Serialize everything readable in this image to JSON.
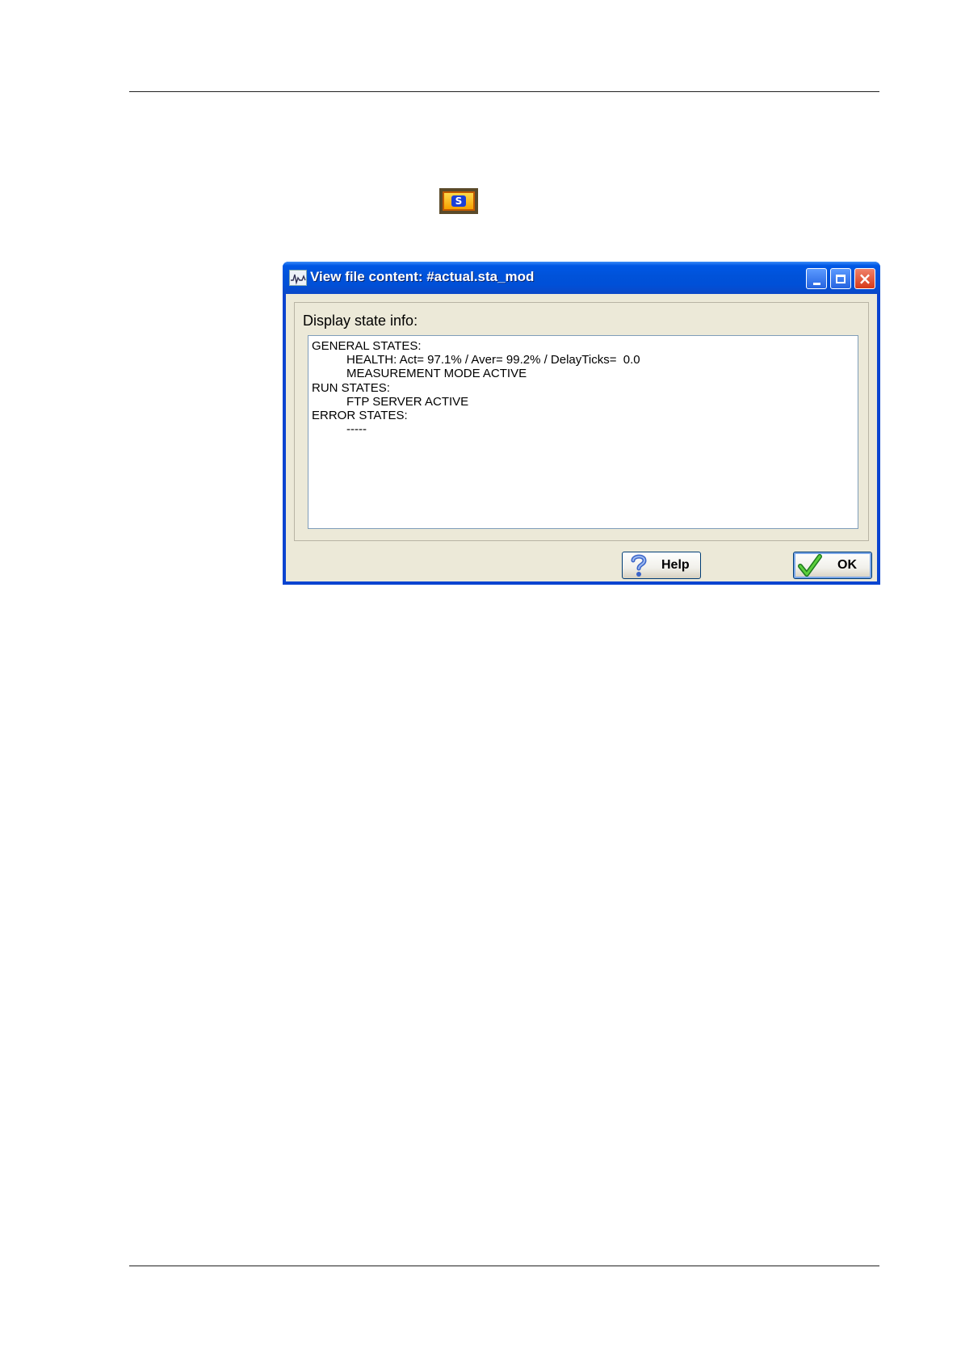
{
  "window": {
    "title": "View file content: #actual.sta_mod",
    "buttons": {
      "minimize": "minimize",
      "maximize": "maximize",
      "close": "close"
    }
  },
  "group": {
    "label": "Display state info:"
  },
  "content": {
    "lines": [
      {
        "text": "GENERAL STATES:",
        "indent": false
      },
      {
        "text": "HEALTH: Act= 97.1% / Aver= 99.2% / DelayTicks=  0.0",
        "indent": true
      },
      {
        "text": "MEASUREMENT MODE ACTIVE",
        "indent": true
      },
      {
        "text": "RUN STATES:",
        "indent": false
      },
      {
        "text": "FTP SERVER ACTIVE",
        "indent": true
      },
      {
        "text": "ERROR STATES:",
        "indent": false
      },
      {
        "text": "-----",
        "indent": true
      }
    ]
  },
  "footer": {
    "help_label": "Help",
    "ok_label": "OK"
  },
  "toolbar_icon": {
    "label": "S",
    "icon": "state-s-icon"
  },
  "colors": {
    "titlebar": "#0054e3",
    "client": "#ece9d8",
    "accent": "#1a3fd8"
  }
}
